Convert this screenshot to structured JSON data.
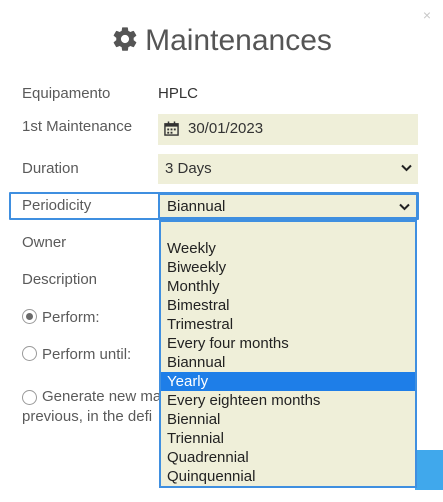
{
  "dialog": {
    "title": "Maintenances",
    "title_icon": "gear-icon",
    "close_label": "×"
  },
  "form": {
    "equipment_label": "Equipamento",
    "equipment_value": "HPLC",
    "first_maintenance_label": "1st Maintenance",
    "first_maintenance_value": "30/01/2023",
    "duration_label": "Duration",
    "duration_value": "3 Days",
    "periodicity_label": "Periodicity",
    "periodicity_value": "Biannual",
    "owner_label": "Owner",
    "description_label": "Description",
    "perform_label": "Perform:",
    "perform_until_label": "Perform until:",
    "generate_line1": "Generate new ma",
    "generate_line2": "previous, in the defi"
  },
  "dropdown": {
    "options": [
      "Weekly",
      "Biweekly",
      "Monthly",
      "Bimestral",
      "Trimestral",
      "Every four months",
      "Biannual",
      "Yearly",
      "Every eighteen months",
      "Biennial",
      "Triennial",
      "Quadrennial",
      "Quinquennial"
    ],
    "highlighted": "Yearly"
  },
  "colors": {
    "field_bg": "#efefd9",
    "focus": "#3f8fe0",
    "highlight": "#1e7ee8",
    "button": "#40a8ec"
  }
}
